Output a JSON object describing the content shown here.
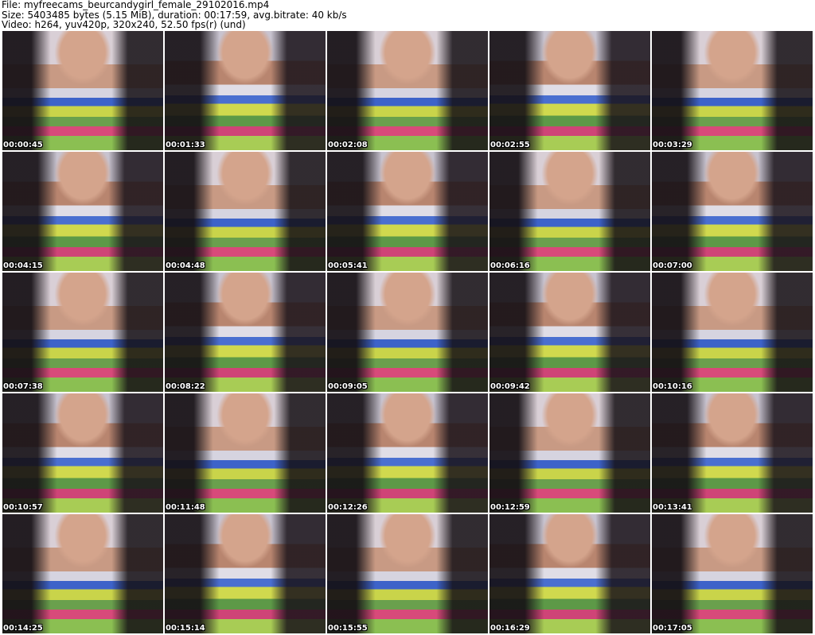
{
  "header": {
    "file_line": "File: myfreecams_beurcandygirl_female_29102016.mp4",
    "size_line": "Size: 5403485 bytes (5.15 MiB), duration: 00:17:59, avg.bitrate: 40 kb/s",
    "video_line": "Video: h264, yuv420p, 320x240, 52.50 fps(r) (und)"
  },
  "thumbnails": [
    "00:00:45",
    "00:01:33",
    "00:02:08",
    "00:02:55",
    "00:03:29",
    "00:04:15",
    "00:04:48",
    "00:05:41",
    "00:06:16",
    "00:07:00",
    "00:07:38",
    "00:08:22",
    "00:09:05",
    "00:09:42",
    "00:10:16",
    "00:10:57",
    "00:11:48",
    "00:12:26",
    "00:12:59",
    "00:13:41",
    "00:14:25",
    "00:15:14",
    "00:15:55",
    "00:16:29",
    "00:17:05"
  ]
}
